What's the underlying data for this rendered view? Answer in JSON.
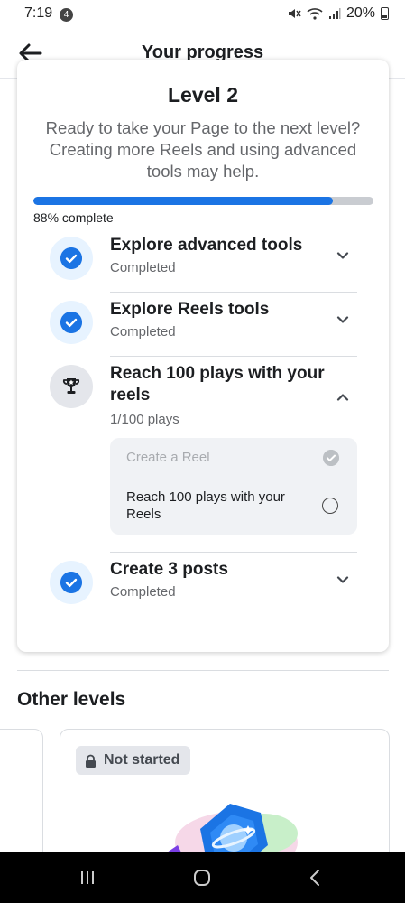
{
  "status_bar": {
    "time": "7:19",
    "notification_count": "4",
    "battery_percent": "20%",
    "icons": [
      "mute-icon",
      "wifi-icon",
      "signal-icon",
      "battery-icon"
    ]
  },
  "header": {
    "title": "Your progress",
    "back_icon": "back-arrow-icon"
  },
  "level_card": {
    "title": "Level 2",
    "description": "Ready to take your Page to the next level? Creating more Reels and using advanced tools may help.",
    "progress_fraction": 0.88,
    "progress_label": "88% complete",
    "accent_color": "#1b74e4",
    "tasks": [
      {
        "title": "Explore advanced tools",
        "status": "Completed",
        "icon": "check-icon",
        "expanded": false
      },
      {
        "title": "Explore Reels tools",
        "status": "Completed",
        "icon": "check-icon",
        "expanded": false
      },
      {
        "title": "Reach 100 plays with your reels",
        "status": "1/100 plays",
        "icon": "trophy-icon",
        "expanded": true,
        "subtasks": [
          {
            "label": "Create a Reel",
            "done": true
          },
          {
            "label": "Reach 100 plays with your Reels",
            "done": false
          }
        ]
      },
      {
        "title": "Create 3 posts",
        "status": "Completed",
        "icon": "check-icon",
        "expanded": false
      }
    ]
  },
  "other_levels": {
    "title": "Other levels",
    "cards": [
      {
        "badge": "Not started",
        "badge_icon": "lock-icon"
      }
    ]
  },
  "nav_bar": {
    "buttons": [
      "recent-apps-icon",
      "home-icon",
      "back-icon"
    ]
  }
}
